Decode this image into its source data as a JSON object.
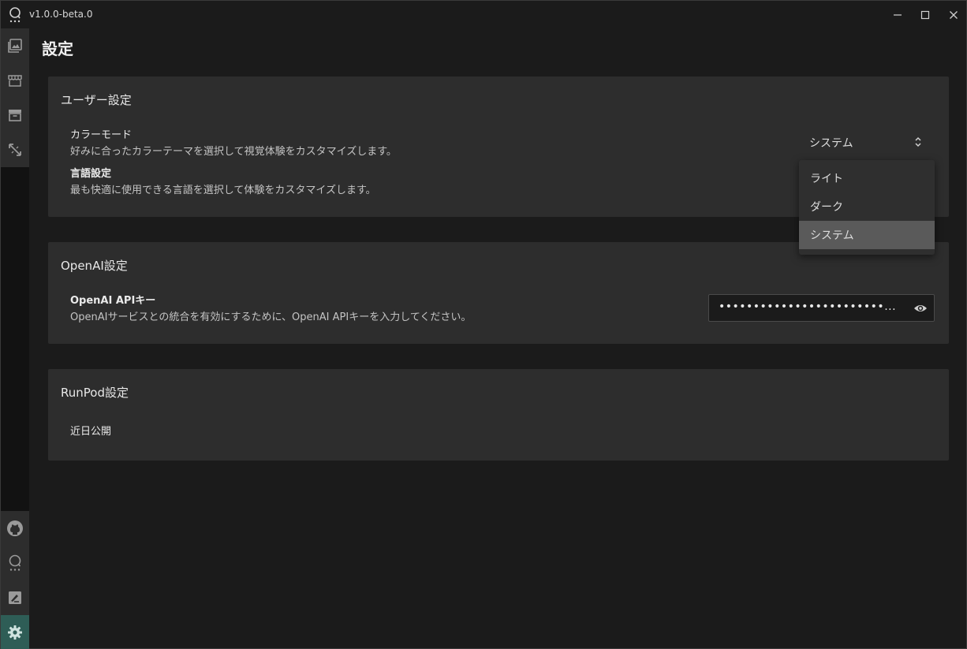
{
  "app": {
    "version": "v1.0.0-beta.0"
  },
  "page": {
    "title": "設定"
  },
  "user_settings": {
    "title": "ユーザー設定",
    "color_mode": {
      "label": "カラーモード",
      "description": "好みに合ったカラーテーマを選択して視覚体験をカスタマイズします。",
      "selected": "システム",
      "options": [
        "ライト",
        "ダーク",
        "システム"
      ],
      "dropdown_open": true
    },
    "language": {
      "label": "言語設定",
      "description": "最も快適に使用できる言語を選択して体験をカスタマイズします。"
    }
  },
  "openai_settings": {
    "title": "OpenAI設定",
    "api_key": {
      "label": "OpenAI APIキー",
      "description": "OpenAIサービスとの統合を有効にするために、OpenAI APIキーを入力してください。",
      "masked_value": "••••••••••••••••••••••••..."
    }
  },
  "runpod_settings": {
    "title": "RunPod設定",
    "status": "近日公開"
  },
  "sidebar": {
    "top_items": [
      "gallery-icon",
      "store-icon",
      "archive-icon",
      "resize-icon"
    ],
    "bottom_items": [
      "github-icon",
      "chat-icon",
      "feedback-icon",
      "settings-icon"
    ],
    "active": "settings-icon"
  },
  "colors": {
    "background": "#1b1b1b",
    "card": "#2d2d2d",
    "active_accent": "#2e5d56",
    "dropdown_selected": "#5a5a5a"
  }
}
